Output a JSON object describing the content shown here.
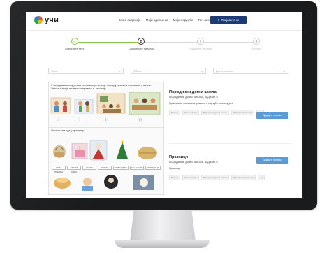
{
  "header": {
    "logo_text": "учи",
    "nav": [
      "Моје садржаје",
      "Моји одељења",
      "Моја поруџбе",
      "Тон листа"
    ],
    "signin_label": "Пријавите се"
  },
  "steps": [
    {
      "label": "Креирајте тест",
      "state": "done",
      "number": "✓"
    },
    {
      "label": "Одаберите питања",
      "state": "active",
      "number": "2"
    },
    {
      "label": "Подесите питања",
      "state": "pending",
      "number": "3"
    },
    {
      "label": "Прегле",
      "state": "pending",
      "number": "4"
    }
  ],
  "filters": {
    "f1": "Тема",
    "f2": "Област",
    "f3": "Врста питања"
  },
  "cards": [
    {
      "question": "У заградама испод слика се налазе речи, које показују правила понашања у школи. Упиши + ако је правило исправно, а - ако није."
    },
    {
      "question": "Означи шта иде у празнику:",
      "chips": [
        "НОВА ГОДИНА",
        "СВЕТИ САВА",
        "УСКРС",
        "БОЖИЋ",
        "РОЂЕНДАН",
        "ДАН ШКОЛЕ",
        "ПОРОДИЦА"
      ]
    }
  ],
  "tasks": [
    {
      "title": "Породични дом и школа",
      "subtitle": "Породични дом и школа, задатак 5",
      "desc": "Правила за понашање у школи и код куће разликују се",
      "tags": [
        "Разред",
        "Свет око нас",
        "Породични дом и школа",
        "Правила понашања",
        "+ 4"
      ],
      "button": "Додајте питање"
    },
    {
      "title": "Празници",
      "subtitle": "Породични дом и школа, задатак 6",
      "desc": "Празници",
      "tags": [
        "Разред",
        "Свет око нас",
        "Породични дом и школа",
        "Породични празници",
        "+ 4"
      ],
      "button": "Додајте питање"
    }
  ],
  "colors": {
    "bezel": "#1a1b1d",
    "accent": "#1c3a78",
    "button": "#5b9bd5",
    "done": "#8bc34a"
  }
}
